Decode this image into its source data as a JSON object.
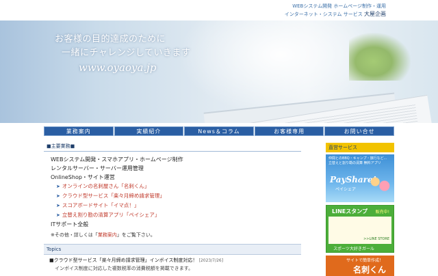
{
  "header": {
    "tagline_1": "WEBシステム開発 ホームページ制作・運用",
    "tagline_2_prefix": "インターネット・システム サービス",
    "company": "大屋企画"
  },
  "hero": {
    "line1": "お客様の目的達成のために",
    "line2": "一緒にチャレンジしていきます",
    "url": "www.oyaoya.jp"
  },
  "nav": [
    "業務案内",
    "実績紹介",
    "News＆コラム",
    "お客様専用",
    "お問い合せ"
  ],
  "main": {
    "section_heading": "■主要業務■",
    "services": [
      "WEBシステム開発・スマホアプリ・ホームページ制作",
      "レンタルサーバー・サーバー運用管理",
      "OnlineShop・サイト運営"
    ],
    "shop_items": [
      "オンラインの名刺屋さん「名刺くん」",
      "クラウド型サービス「楽々月締め請求管理」",
      "スコアボードサイト「イマ点！」",
      "立替え割り勘の清算アプリ「ペイシェア」"
    ],
    "it_support": "ITサポート全般",
    "note_prefix": "※その他・詳しくは「",
    "note_link": "業務案内",
    "note_suffix": "」をご覧下さい。",
    "topics_label": "Topics",
    "topic_title": "■クラウド型サービス「楽々月締め請求管理」インボイス制度対応！",
    "topic_date": "[2023/7/26]",
    "topic_desc": "インボイス制度に対応した複数税率の消費税額を掲載できます。"
  },
  "sidebar": {
    "heading": "直営サービス",
    "banner1_text": "仲間とのBBQ・キャンプ・旅行など...\n立替えと割り勘の清算 無料アプリ",
    "banner1_logo": "PayShare!",
    "banner1_sub": "ペイシェア",
    "banner2_title": "LINEスタンプ",
    "banner2_badge": "販売中!",
    "banner2_store": ">>LINE STORE",
    "banner2_caption": "スポーツ大好きガール",
    "banner3_top": "サイトで簡単作成！",
    "banner3_main": "名刺くん"
  },
  "colors": {
    "nav_bg": "#2a5ea3",
    "side_heading_bg": "#f2c300",
    "link_red": "#c0392b"
  }
}
